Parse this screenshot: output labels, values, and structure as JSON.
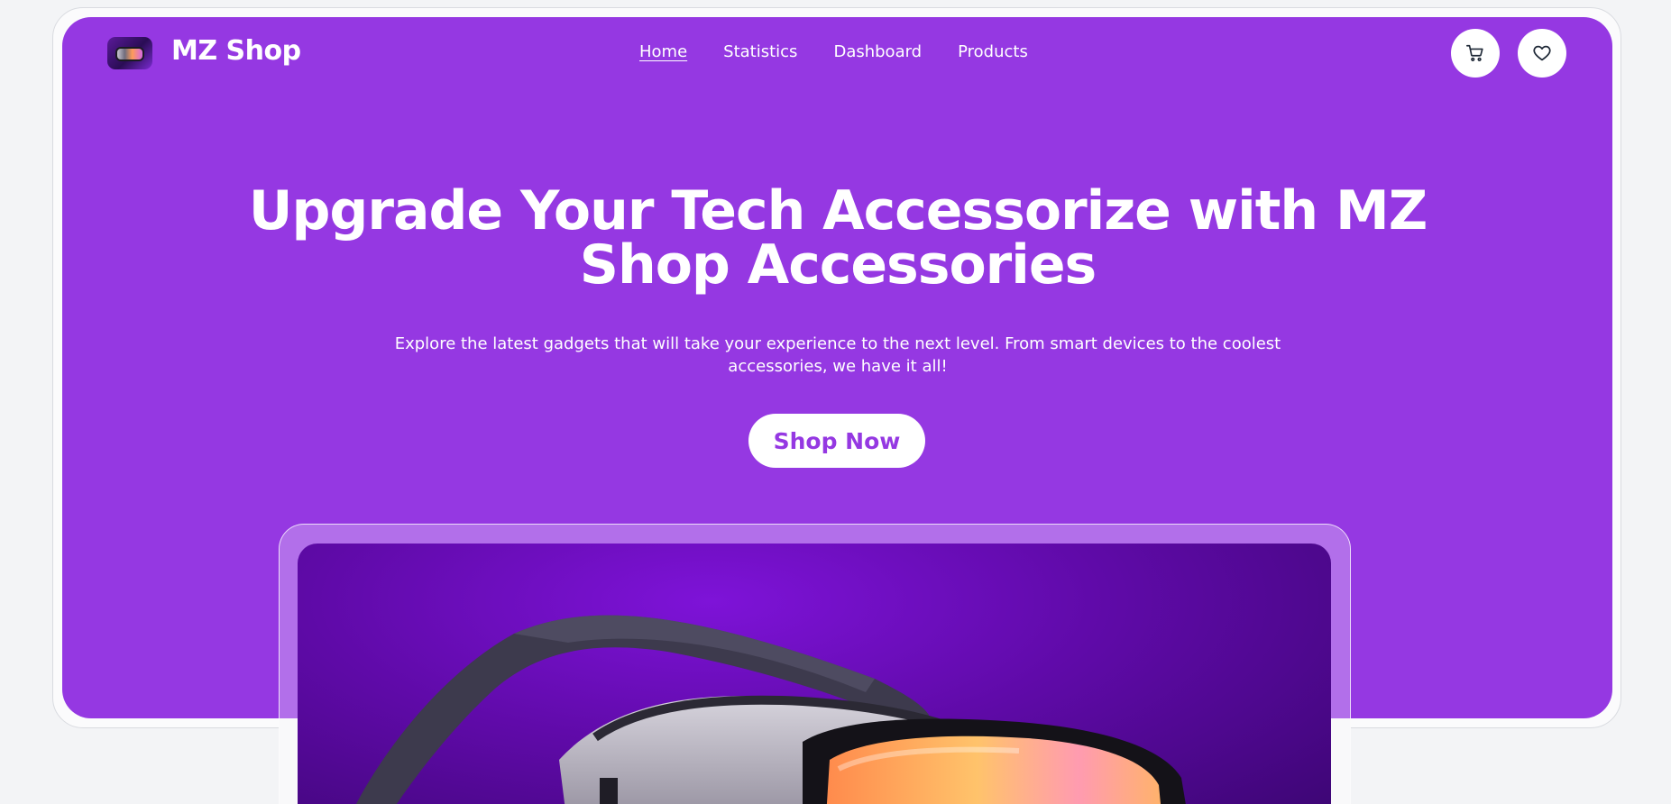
{
  "brand": {
    "name": "MZ Shop"
  },
  "nav": {
    "links": [
      {
        "label": "Home",
        "active": true
      },
      {
        "label": "Statistics",
        "active": false
      },
      {
        "label": "Dashboard",
        "active": false
      },
      {
        "label": "Products",
        "active": false
      }
    ]
  },
  "actions": {
    "cart_icon": "cart-icon",
    "wishlist_icon": "heart-icon"
  },
  "hero": {
    "headline_line1": "Upgrade Your Tech Accessorize with MZ",
    "headline_line2": "Shop Accessories",
    "subtitle_line1": "Explore the latest gadgets that will take your experience to the next level. From smart devices to the coolest",
    "subtitle_line2": "accessories, we have it all!",
    "cta_label": "Shop Now",
    "banner_subject": "vr-headset"
  },
  "colors": {
    "primary": "#9538e2",
    "background": "#f3f4f6",
    "white": "#ffffff"
  }
}
